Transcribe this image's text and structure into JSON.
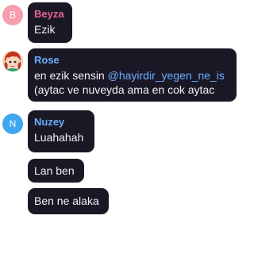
{
  "messages": [
    {
      "sender": "Beyza",
      "sender_color": "#e8638f",
      "avatar": {
        "type": "initial",
        "letter": "B",
        "bg": "#f59eae"
      },
      "lines": [
        "Ezik"
      ]
    },
    {
      "sender": "Rose",
      "sender_color": "#69aeff",
      "avatar": {
        "type": "image",
        "icon": "red-haired-cartoon-avatar-icon"
      },
      "line1_prefix": "en ezik sensin ",
      "line1_mention": "@hayirdir_yegen_ne_is",
      "line2": "(aytac ve nuveyda ama en cok aytac"
    },
    {
      "sender": "Nuzey",
      "sender_color": "#69aeff",
      "avatar": {
        "type": "initial",
        "letter": "N",
        "bg": "#3fa7f0"
      },
      "lines": [
        "Luahahah",
        "Lan ben",
        "Ben ne alaka"
      ]
    }
  ]
}
